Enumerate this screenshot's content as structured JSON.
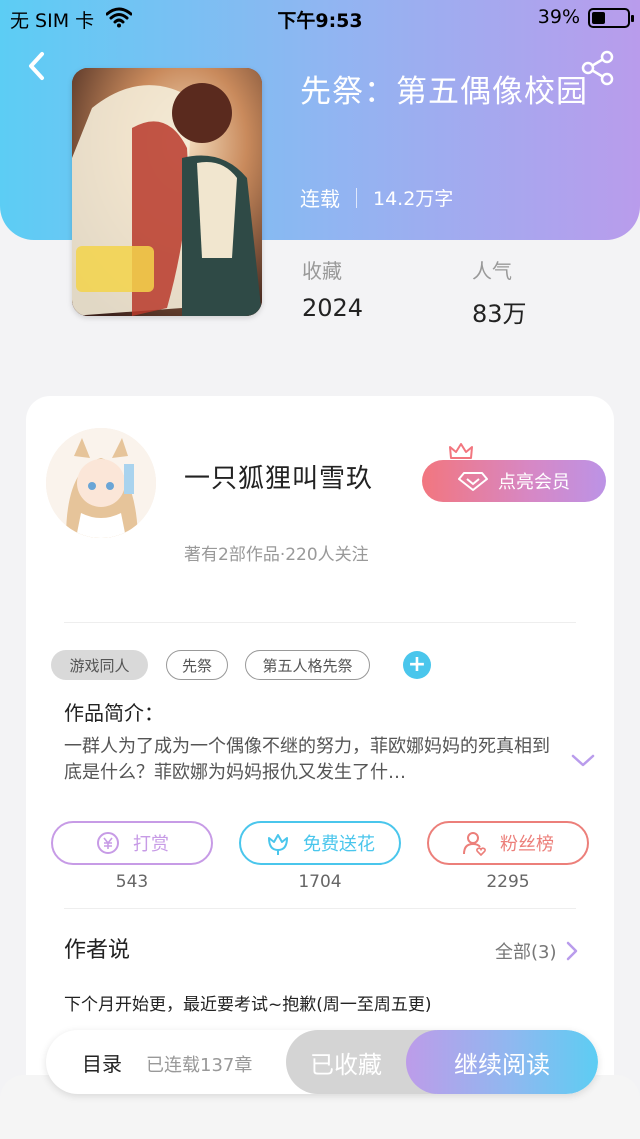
{
  "statusbar": {
    "carrier": "无 SIM 卡",
    "time": "下午9:53",
    "battery": "39%",
    "battery_level": 0.39
  },
  "book": {
    "title": "先祭：第五偶像校园",
    "status": "连载",
    "word_count": "14.2万字",
    "stats": [
      {
        "label": "收藏",
        "value": "2024"
      },
      {
        "label": "人气",
        "value": "83万"
      }
    ]
  },
  "author": {
    "name": "一只狐狸叫雪玖",
    "subtitle": "著有2部作品·220人关注",
    "vip_button": "点亮会员"
  },
  "tags": [
    {
      "label": "游戏同人",
      "style": "filled"
    },
    {
      "label": "先祭",
      "style": "outline"
    },
    {
      "label": "第五人格先祭",
      "style": "outline"
    }
  ],
  "intro": {
    "label": "作品简介：",
    "text": "一群人为了成为一个偶像不继的努力，菲欧娜妈妈的死真相到底是什么？菲欧娜为妈妈报仇又发生了什…"
  },
  "actions": [
    {
      "label": "打赏",
      "count": "543",
      "color": "#c79be6",
      "icon": "coin-icon"
    },
    {
      "label": "免费送花",
      "count": "1704",
      "color": "#4ac6ec",
      "icon": "flower-icon"
    },
    {
      "label": "粉丝榜",
      "count": "2295",
      "color": "#ec7f7a",
      "icon": "fans-icon"
    }
  ],
  "author_says": {
    "label": "作者说",
    "all_label": "全部(3)",
    "text": "下个月开始更，最近要考试~抱歉(周一至周五更)"
  },
  "bottom_bar": {
    "toc_label": "目录",
    "chapters_label": "已连载137章",
    "collected_label": "已收藏",
    "read_label": "继续阅读"
  },
  "colors": {
    "accent_blue": "#4ac6ec",
    "accent_purple": "#b99cec",
    "vip_pink": "#f2767f"
  }
}
